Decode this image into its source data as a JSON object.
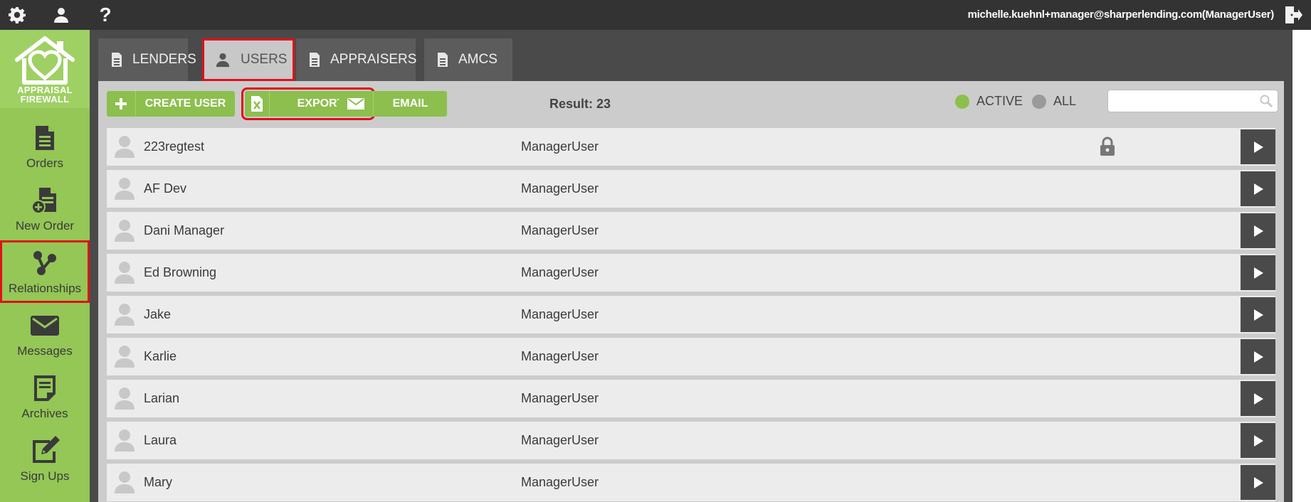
{
  "topbar": {
    "user_email": "michelle.kuehnl+manager@sharperlending.com(ManagerUser)",
    "icons": [
      "gear-icon",
      "user-icon",
      "help-icon",
      "logout-icon"
    ]
  },
  "logo": {
    "line1": "APPRAISAL",
    "line2": "FIREWALL"
  },
  "sidebar": {
    "items": [
      {
        "label": "Orders",
        "icon": "document-icon"
      },
      {
        "label": "New Order",
        "icon": "new-order-icon"
      },
      {
        "label": "Relationships",
        "icon": "relationships-icon"
      },
      {
        "label": "Messages",
        "icon": "envelope-icon"
      },
      {
        "label": "Archives",
        "icon": "archive-icon"
      },
      {
        "label": "Sign Ups",
        "icon": "signup-icon"
      }
    ]
  },
  "tabs": [
    {
      "label": "LENDERS",
      "icon": "document-icon"
    },
    {
      "label": "USERS",
      "icon": "user-icon"
    },
    {
      "label": "APPRAISERS",
      "icon": "document-icon"
    },
    {
      "label": "AMCS",
      "icon": "document-icon"
    }
  ],
  "toolbar": {
    "create_label": "CREATE USER",
    "export_label": "EXPORT",
    "email_label": "EMAIL",
    "result_text": "Result: 23",
    "filter_active": "ACTIVE",
    "filter_all": "ALL",
    "search_placeholder": ""
  },
  "users": [
    {
      "name": "223regtest",
      "role": "ManagerUser",
      "locked": true
    },
    {
      "name": "AF Dev",
      "role": "ManagerUser",
      "locked": false
    },
    {
      "name": "Dani Manager",
      "role": "ManagerUser",
      "locked": false
    },
    {
      "name": "Ed Browning",
      "role": "ManagerUser",
      "locked": false
    },
    {
      "name": "Jake",
      "role": "ManagerUser",
      "locked": false
    },
    {
      "name": "Karlie",
      "role": "ManagerUser",
      "locked": false
    },
    {
      "name": "Larian",
      "role": "ManagerUser",
      "locked": false
    },
    {
      "name": "Laura",
      "role": "ManagerUser",
      "locked": false
    },
    {
      "name": "Mary",
      "role": "ManagerUser",
      "locked": false
    }
  ],
  "colors": {
    "accent_green": "#8cbf4e",
    "sidebar_green": "#94c756",
    "highlight_red": "#e0101a",
    "dark_gray": "#4a4a4a"
  }
}
